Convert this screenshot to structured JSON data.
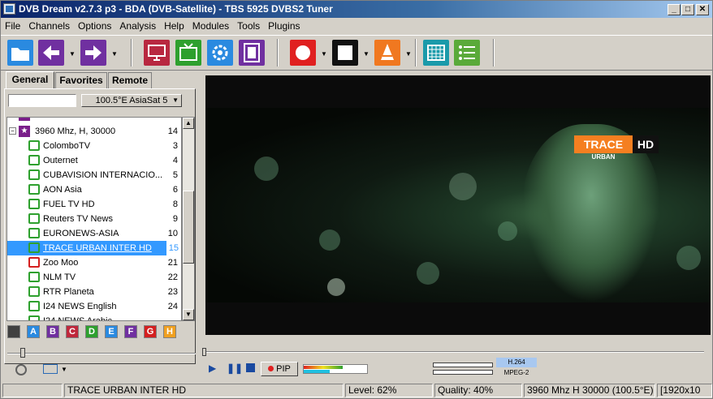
{
  "window": {
    "title": "DVB Dream v2.7.3 p3 - BDA (DVB-Satellite)  -  TBS 5925 DVBS2 Tuner",
    "min": "_",
    "max": "□",
    "close": "✕"
  },
  "menu": [
    "File",
    "Channels",
    "Options",
    "Analysis",
    "Help",
    "Modules",
    "Tools",
    "Plugins"
  ],
  "tabs": [
    "General",
    "Favorites",
    "Remote"
  ],
  "satellite": "100.5°E AsiaSat 5",
  "transponder": {
    "label": "3960 Mhz, H, 30000",
    "count": "14"
  },
  "channels": [
    {
      "name": "ColomboTV",
      "num": "3",
      "color": "green"
    },
    {
      "name": "Outernet",
      "num": "4",
      "color": "green"
    },
    {
      "name": "CUBAVISION INTERNACIO...",
      "num": "5",
      "color": "green"
    },
    {
      "name": "AON Asia",
      "num": "6",
      "color": "green"
    },
    {
      "name": "FUEL TV HD",
      "num": "8",
      "color": "green"
    },
    {
      "name": "Reuters TV News",
      "num": "9",
      "color": "green"
    },
    {
      "name": "EURONEWS-ASIA",
      "num": "10",
      "color": "green"
    },
    {
      "name": "TRACE URBAN INTER HD",
      "num": "15",
      "color": "green",
      "selected": true
    },
    {
      "name": "Zoo Moo",
      "num": "21",
      "color": "red"
    },
    {
      "name": "NLM TV",
      "num": "22",
      "color": "green"
    },
    {
      "name": "RTR Planeta",
      "num": "23",
      "color": "green"
    },
    {
      "name": "I24 NEWS English",
      "num": "24",
      "color": "green"
    },
    {
      "name": "I24 NEWS Arabic",
      "num": "",
      "color": "green"
    }
  ],
  "letters": [
    {
      "l": "",
      "c": "#404040"
    },
    {
      "l": "A",
      "c": "#2a8ae0"
    },
    {
      "l": "B",
      "c": "#7030a0"
    },
    {
      "l": "C",
      "c": "#c0283c"
    },
    {
      "l": "D",
      "c": "#2ea02e"
    },
    {
      "l": "E",
      "c": "#2a8ae0"
    },
    {
      "l": "F",
      "c": "#7030a0"
    },
    {
      "l": "G",
      "c": "#d42020"
    },
    {
      "l": "H",
      "c": "#f0a020"
    }
  ],
  "video": {
    "logo_main": "TRACE",
    "logo_hd": "HD",
    "logo_sub": "URBAN"
  },
  "controls": {
    "pip": "PIP",
    "codec": "H.264",
    "format": "MPEG-2"
  },
  "status": {
    "channel": "TRACE URBAN INTER HD",
    "level": "Level: 62%",
    "quality": "Quality: 40%",
    "tp": "3960 Mhz  H  30000  (100.5°E)",
    "res": "[1920x10"
  },
  "colors": {
    "accent": "#0a246a",
    "selection": "#3399ff",
    "trace_orange": "#f57f20"
  }
}
